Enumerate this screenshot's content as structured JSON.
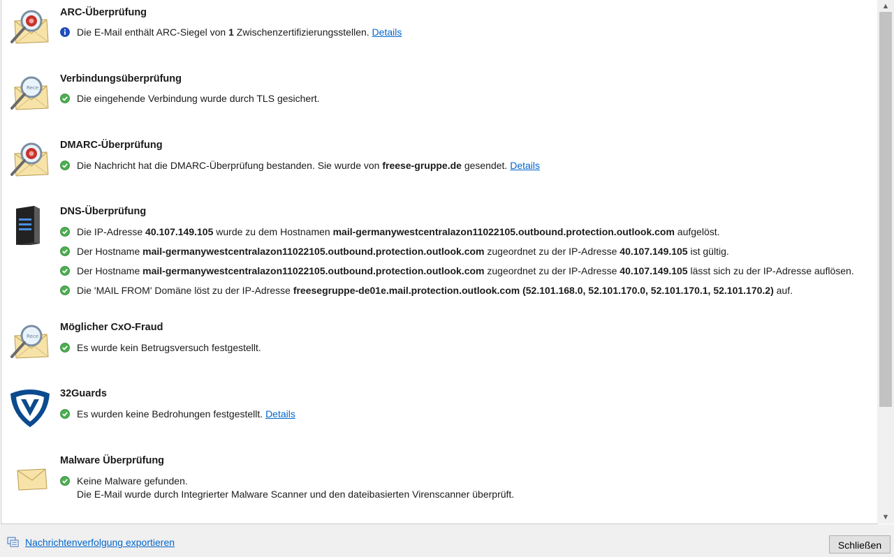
{
  "sections": {
    "arc": {
      "title": "ARC-Überprüfung",
      "line1": {
        "pre": "Die E-Mail enthält ARC-Siegel von ",
        "bold": "1",
        "post": " Zwischenzertifizierungsstellen. ",
        "link": "Details"
      }
    },
    "connection": {
      "title": "Verbindungsüberprüfung",
      "line1": "Die eingehende Verbindung wurde durch TLS gesichert."
    },
    "dmarc": {
      "title": "DMARC-Überprüfung",
      "line1": {
        "pre": "Die Nachricht hat die DMARC-Überprüfung bestanden. Sie wurde von ",
        "bold": "freese-gruppe.de",
        "post": " gesendet. ",
        "link": "Details"
      }
    },
    "dns": {
      "title": "DNS-Überprüfung",
      "line1": {
        "a": "Die IP-Adresse ",
        "b": "40.107.149.105",
        "c": " wurde zu dem Hostnamen ",
        "d": "mail-germanywestcentralazon11022105.outbound.protection.outlook.com",
        "e": " aufgelöst."
      },
      "line2": {
        "a": "Der Hostname ",
        "b": "mail-germanywestcentralazon11022105.outbound.protection.outlook.com",
        "c": " zugeordnet zu der IP-Adresse ",
        "d": "40.107.149.105",
        "e": " ist gültig."
      },
      "line3": {
        "a": "Der Hostname ",
        "b": "mail-germanywestcentralazon11022105.outbound.protection.outlook.com",
        "c": " zugeordnet zu der IP-Adresse ",
        "d": "40.107.149.105",
        "e": " lässt sich zu der IP-Adresse auflösen."
      },
      "line4": {
        "a": "Die 'MAIL FROM' Domäne löst zu der IP-Adresse ",
        "b": "freesegruppe-de01e.mail.protection.outlook.com (52.101.168.0, 52.101.170.0, 52.101.170.1, 52.101.170.2)",
        "c": " auf."
      }
    },
    "cxo": {
      "title": "Möglicher CxO-Fraud",
      "line1": "Es wurde kein Betrugsversuch festgestellt."
    },
    "guards": {
      "title": "32Guards",
      "line1": {
        "pre": "Es wurden keine Bedrohungen festgestellt. ",
        "link": "Details"
      }
    },
    "malware": {
      "title": "Malware Überprüfung",
      "line1": "Keine Malware gefunden.",
      "line2": "Die E-Mail wurde durch Integrierter Malware Scanner und den dateibasierten Virenscanner überprüft."
    }
  },
  "footer": {
    "export_link": "Nachrichtenverfolgung exportieren",
    "close_button": "Schließen"
  },
  "colors": {
    "ok": "#5cb85c",
    "info": "#1a4fc7",
    "link": "#0066cc"
  }
}
